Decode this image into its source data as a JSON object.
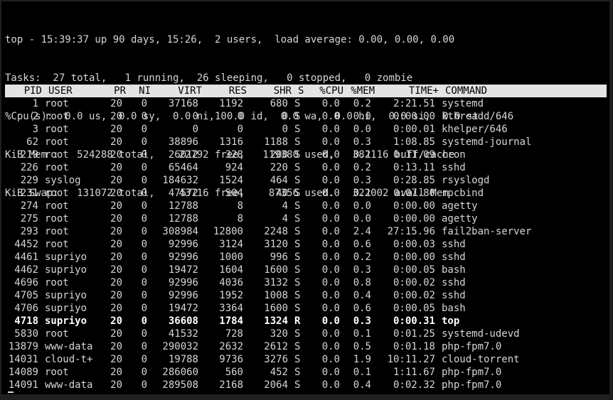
{
  "summary": {
    "line1": "top - 15:39:37 up 90 days, 15:26,  2 users,  load average: 0.00, 0.00, 0.00",
    "line2": "Tasks:  27 total,   1 running,  26 sleeping,   0 stopped,   0 zombie",
    "line3": "%Cpu(s):  0.0 us,  0.0 sy,  0.0 ni,100.0 id,  0.0 wa,  0.0 hi,  0.0 si,  0.0 st",
    "line4": "KiB Mem :   524288 total,    22792 free,   119380 used,   382116 buff/cache",
    "line5": "KiB Swap:   131072 total,    43716 free,    87356 used.   322002 avail Mem"
  },
  "columns": {
    "pid": "PID",
    "user": "USER",
    "pr": "PR",
    "ni": "NI",
    "virt": "VIRT",
    "res": "RES",
    "shr": "SHR",
    "s": "S",
    "cpu": "%CPU",
    "mem": "%MEM",
    "time": "TIME+",
    "command": "COMMAND"
  },
  "processes": [
    {
      "pid": "1",
      "user": "root",
      "pr": "20",
      "ni": "0",
      "virt": "37168",
      "res": "1192",
      "shr": "680",
      "s": "S",
      "cpu": "0.0",
      "mem": "0.2",
      "time": "2:21.51",
      "command": "systemd"
    },
    {
      "pid": "2",
      "user": "root",
      "pr": "20",
      "ni": "0",
      "virt": "0",
      "res": "0",
      "shr": "0",
      "s": "S",
      "cpu": "0.0",
      "mem": "0.0",
      "time": "0:00.00",
      "command": "kthreadd/646"
    },
    {
      "pid": "3",
      "user": "root",
      "pr": "20",
      "ni": "0",
      "virt": "0",
      "res": "0",
      "shr": "0",
      "s": "S",
      "cpu": "0.0",
      "mem": "0.0",
      "time": "0:00.01",
      "command": "khelper/646"
    },
    {
      "pid": "62",
      "user": "root",
      "pr": "20",
      "ni": "0",
      "virt": "38896",
      "res": "1316",
      "shr": "1188",
      "s": "S",
      "cpu": "0.0",
      "mem": "0.3",
      "time": "1:08.85",
      "command": "systemd-journal"
    },
    {
      "pid": "219",
      "user": "root",
      "pr": "20",
      "ni": "0",
      "virt": "26012",
      "res": "328",
      "shr": "200",
      "s": "S",
      "cpu": "0.0",
      "mem": "0.1",
      "time": "0:11.09",
      "command": "cron"
    },
    {
      "pid": "226",
      "user": "root",
      "pr": "20",
      "ni": "0",
      "virt": "65464",
      "res": "924",
      "shr": "220",
      "s": "S",
      "cpu": "0.0",
      "mem": "0.2",
      "time": "0:13.11",
      "command": "sshd"
    },
    {
      "pid": "229",
      "user": "syslog",
      "pr": "20",
      "ni": "0",
      "virt": "184632",
      "res": "1524",
      "shr": "464",
      "s": "S",
      "cpu": "0.0",
      "mem": "0.3",
      "time": "0:28.85",
      "command": "rsyslogd"
    },
    {
      "pid": "231",
      "user": "root",
      "pr": "20",
      "ni": "0",
      "virt": "47572",
      "res": "504",
      "shr": "40",
      "s": "S",
      "cpu": "0.0",
      "mem": "0.1",
      "time": "0:07.80",
      "command": "rpcbind"
    },
    {
      "pid": "274",
      "user": "root",
      "pr": "20",
      "ni": "0",
      "virt": "12788",
      "res": "8",
      "shr": "4",
      "s": "S",
      "cpu": "0.0",
      "mem": "0.0",
      "time": "0:00.00",
      "command": "agetty"
    },
    {
      "pid": "275",
      "user": "root",
      "pr": "20",
      "ni": "0",
      "virt": "12788",
      "res": "8",
      "shr": "4",
      "s": "S",
      "cpu": "0.0",
      "mem": "0.0",
      "time": "0:00.00",
      "command": "agetty"
    },
    {
      "pid": "293",
      "user": "root",
      "pr": "20",
      "ni": "0",
      "virt": "308984",
      "res": "12800",
      "shr": "2248",
      "s": "S",
      "cpu": "0.0",
      "mem": "2.4",
      "time": "27:15.96",
      "command": "fail2ban-server"
    },
    {
      "pid": "4452",
      "user": "root",
      "pr": "20",
      "ni": "0",
      "virt": "92996",
      "res": "3124",
      "shr": "3120",
      "s": "S",
      "cpu": "0.0",
      "mem": "0.6",
      "time": "0:00.03",
      "command": "sshd"
    },
    {
      "pid": "4461",
      "user": "supriyo",
      "pr": "20",
      "ni": "0",
      "virt": "92996",
      "res": "1000",
      "shr": "996",
      "s": "S",
      "cpu": "0.0",
      "mem": "0.2",
      "time": "0:00.00",
      "command": "sshd"
    },
    {
      "pid": "4462",
      "user": "supriyo",
      "pr": "20",
      "ni": "0",
      "virt": "19472",
      "res": "1604",
      "shr": "1600",
      "s": "S",
      "cpu": "0.0",
      "mem": "0.3",
      "time": "0:00.05",
      "command": "bash"
    },
    {
      "pid": "4696",
      "user": "root",
      "pr": "20",
      "ni": "0",
      "virt": "92996",
      "res": "4036",
      "shr": "3132",
      "s": "S",
      "cpu": "0.0",
      "mem": "0.8",
      "time": "0:00.02",
      "command": "sshd"
    },
    {
      "pid": "4705",
      "user": "supriyo",
      "pr": "20",
      "ni": "0",
      "virt": "92996",
      "res": "1952",
      "shr": "1008",
      "s": "S",
      "cpu": "0.0",
      "mem": "0.4",
      "time": "0:00.02",
      "command": "sshd"
    },
    {
      "pid": "4706",
      "user": "supriyo",
      "pr": "20",
      "ni": "0",
      "virt": "19472",
      "res": "3364",
      "shr": "1600",
      "s": "S",
      "cpu": "0.0",
      "mem": "0.6",
      "time": "0:00.05",
      "command": "bash"
    },
    {
      "pid": "4718",
      "user": "supriyo",
      "pr": "20",
      "ni": "0",
      "virt": "36608",
      "res": "1784",
      "shr": "1324",
      "s": "R",
      "cpu": "0.0",
      "mem": "0.3",
      "time": "0:00.31",
      "command": "top",
      "bold": true
    },
    {
      "pid": "5830",
      "user": "root",
      "pr": "20",
      "ni": "0",
      "virt": "41532",
      "res": "728",
      "shr": "320",
      "s": "S",
      "cpu": "0.0",
      "mem": "0.1",
      "time": "0:01.25",
      "command": "systemd-udevd"
    },
    {
      "pid": "13879",
      "user": "www-data",
      "pr": "20",
      "ni": "0",
      "virt": "290032",
      "res": "2632",
      "shr": "2612",
      "s": "S",
      "cpu": "0.0",
      "mem": "0.5",
      "time": "0:01.18",
      "command": "php-fpm7.0"
    },
    {
      "pid": "14031",
      "user": "cloud-t+",
      "pr": "20",
      "ni": "0",
      "virt": "19788",
      "res": "9736",
      "shr": "3276",
      "s": "S",
      "cpu": "0.0",
      "mem": "1.9",
      "time": "10:11.27",
      "command": "cloud-torrent"
    },
    {
      "pid": "14089",
      "user": "root",
      "pr": "20",
      "ni": "0",
      "virt": "286060",
      "res": "560",
      "shr": "452",
      "s": "S",
      "cpu": "0.0",
      "mem": "0.1",
      "time": "1:11.67",
      "command": "php-fpm7.0"
    },
    {
      "pid": "14091",
      "user": "www-data",
      "pr": "20",
      "ni": "0",
      "virt": "289508",
      "res": "2168",
      "shr": "2064",
      "s": "S",
      "cpu": "0.0",
      "mem": "0.4",
      "time": "0:02.32",
      "command": "php-fpm7.0"
    }
  ]
}
